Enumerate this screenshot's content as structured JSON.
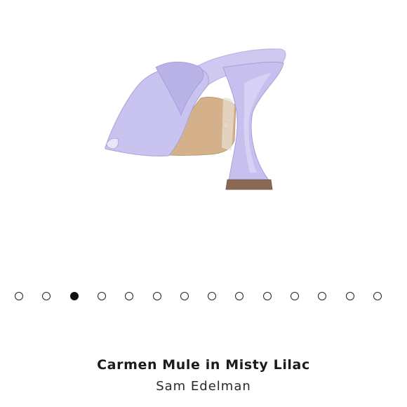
{
  "product": {
    "name": "Carmen Mule in Misty Lilac",
    "brand": "Sam Edelman",
    "image_alt": "product-image"
  },
  "carousel": {
    "total": 14,
    "active_index": 2
  },
  "colors": {
    "shoe_lilac": "#c9c3ef",
    "shoe_lilac_shadow": "#a9a2d8",
    "insole_tan": "#d2b08c",
    "heel_tip": "#8a6a55",
    "dot_active": "#111111"
  }
}
